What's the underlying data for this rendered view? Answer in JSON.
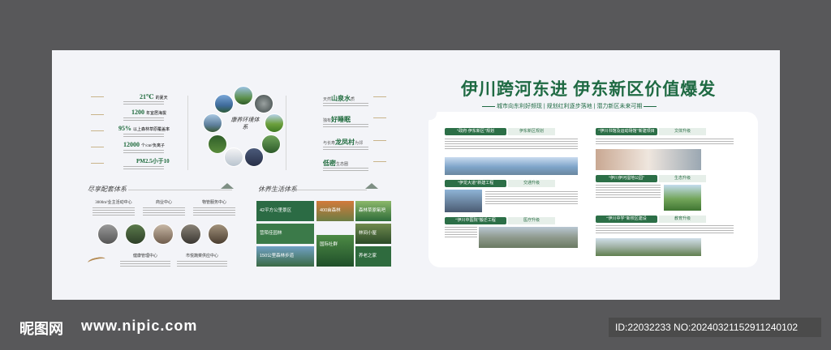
{
  "title": "伊川跨河东进  伊东新区价值爆发",
  "subtitle": "城市向东利好频现 | 规划红利逐步落地 | 潜力新区未来可期",
  "eco": {
    "stats": [
      {
        "big": "21℃",
        "small": "的夏天"
      },
      {
        "big": "1200",
        "small": "年宜居海拔"
      },
      {
        "big": "95%",
        "small": "以上森林草原覆盖率"
      },
      {
        "big": "12000",
        "small": "个/cm³负离子"
      },
      {
        "big": "PM2.5小于10",
        "small": ""
      }
    ],
    "right_items": [
      {
        "pre": "天然",
        "big": "山泉水",
        "post": "质"
      },
      {
        "pre": "独有",
        "big": "好睡眠",
        "post": ""
      },
      {
        "pre": "与长寿",
        "big": "龙凤村",
        "post": "为邻"
      },
      {
        "pre": "",
        "big": "低密",
        "post": "生态圈"
      }
    ],
    "center_title": "康养环境体系"
  },
  "service": {
    "heading": "尽享配套体系",
    "col1": {
      "title": "3000m²业主活动中心"
    },
    "col2": {
      "title": "商业中心"
    },
    "col3": {
      "title": "物管服务中心"
    },
    "bottom1": "健康管理中心",
    "bottom2": "市悦蔬菜供应中心"
  },
  "life": {
    "heading": "休养生活体系",
    "tiles": [
      "42平方公里景区",
      "400亩森林",
      "森林草原氧吧",
      "营陌佳园林",
      "150公里森林步道",
      "国际社群",
      "林间小屋",
      "养老之家"
    ]
  },
  "news": [
    {
      "tag": "“政府·伊东新区”规划",
      "sub": "伊东新区规划"
    },
    {
      "tag": "“伊龙大道”新建工程",
      "sub": "交通升级"
    },
    {
      "tag": "“伊川中医院”搬迁工程",
      "sub": "医疗升级"
    },
    {
      "tag": "“伊川书馆及运动场馆”新建项目",
      "sub": "文体升级"
    },
    {
      "tag": "“伊川伊河湿地公园”",
      "sub": "生态升级"
    },
    {
      "tag": "“伊川中学”新校区建设",
      "sub": "教育升级"
    }
  ],
  "watermark": {
    "logo": "昵图网",
    "url": "www.nipic.com"
  },
  "idline": "ID:22032233 NO:20240321152911240102"
}
